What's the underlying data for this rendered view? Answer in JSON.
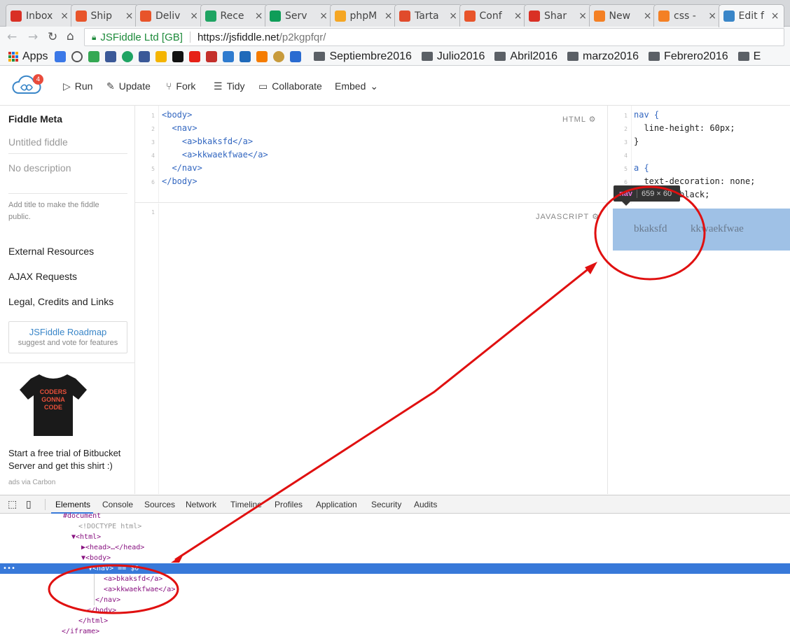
{
  "browser": {
    "tabs": [
      {
        "title": "Inbox",
        "icon": "gmail-icon",
        "color": "#d93025"
      },
      {
        "title": "Ship",
        "icon": "magento-icon",
        "color": "#e8542a"
      },
      {
        "title": "Deliv",
        "icon": "magento-icon",
        "color": "#e8542a"
      },
      {
        "title": "Rece",
        "icon": "google-drive-icon",
        "color": "#1fa463"
      },
      {
        "title": "Serv",
        "icon": "google-sheets-icon",
        "color": "#0f9d58"
      },
      {
        "title": "phpM",
        "icon": "phpmyadmin-icon",
        "color": "#f5a623"
      },
      {
        "title": "Tarta",
        "icon": "tartarus-icon",
        "color": "#e04b2c"
      },
      {
        "title": "Conf",
        "icon": "magento-icon",
        "color": "#e8542a"
      },
      {
        "title": "Shar",
        "icon": "gmail-icon",
        "color": "#d93025"
      },
      {
        "title": "New",
        "icon": "stackoverflow-icon",
        "color": "#f48024"
      },
      {
        "title": "css -",
        "icon": "stackoverflow-icon",
        "color": "#f48024"
      },
      {
        "title": "Edit f",
        "icon": "jsfiddle-icon",
        "color": "#3a86c8"
      }
    ],
    "secure_label": "JSFiddle Ltd [GB]",
    "url_host": "https://jsfiddle.net",
    "url_path": "/p2kgpfqr/",
    "bookmarks": {
      "apps_label": "Apps",
      "folders": [
        "Septiembre2016",
        "Julio2016",
        "Abril2016",
        "marzo2016",
        "Febrero2016",
        "E"
      ]
    }
  },
  "jsfiddle": {
    "badge_count": "4",
    "actions": {
      "run": "Run",
      "update": "Update",
      "fork": "Fork",
      "tidy": "Tidy",
      "collaborate": "Collaborate",
      "embed": "Embed"
    },
    "sidebar": {
      "title": "Fiddle Meta",
      "title_placeholder": "Untitled fiddle",
      "description_placeholder": "No description",
      "hint": "Add title to make the fiddle public.",
      "links": [
        "External Resources",
        "AJAX Requests",
        "Legal, Credits and Links"
      ],
      "roadmap_title": "JSFiddle Roadmap",
      "roadmap_sub": "suggest and vote for features",
      "ad_shirt_text": "CODERS GONNA CODE",
      "ad_text": "Start a free trial of Bitbucket Server and get this shirt :)",
      "ad_via": "ads via Carbon"
    },
    "html_label": "HTML",
    "js_label": "JAVASCRIPT",
    "html_lines": [
      "<body>",
      "  <nav>",
      "    <a>bkaksfd</a>",
      "    <a>kkwaekfwae</a>",
      "  </nav>",
      "</body>"
    ],
    "css_lines": [
      "nav {",
      "  line-height: 60px;",
      "}",
      "",
      "a {",
      "  text-decoration: none;",
      "  color: black;"
    ],
    "line_numbers": [
      "1",
      "2",
      "3",
      "4",
      "5",
      "6",
      "7"
    ],
    "result_links": [
      "bkaksfd",
      "kkwaekfwae"
    ],
    "tooltip": {
      "tag": "nav",
      "size": "659 × 60"
    }
  },
  "devtools": {
    "tabs": [
      "Elements",
      "Console",
      "Sources",
      "Network",
      "Timeline",
      "Profiles",
      "Application",
      "Security",
      "Audits"
    ],
    "tree": [
      "#document",
      "<!DOCTYPE html>",
      "▼<html>",
      "▶<head>…</head>",
      "▼<body>",
      "▼<nav> == $0",
      "<a>bkaksfd</a>",
      "<a>kkwaekfwae</a>",
      "</nav>",
      "</body>",
      "</html>",
      "</iframe>"
    ]
  },
  "colors": {
    "annotation": "#e01010",
    "selection": "#3879d9",
    "result_bg": "#9fc1e6"
  }
}
